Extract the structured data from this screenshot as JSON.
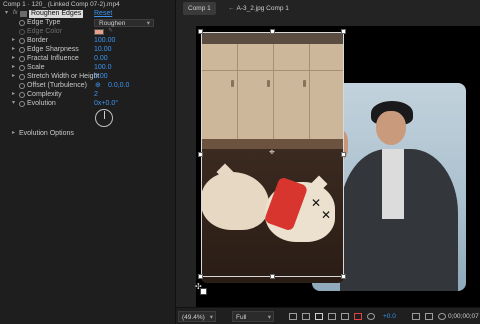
{
  "effect_controls": {
    "header": "Comp 1 · 120_ (Linked Comp 07-2).mp4",
    "effect_name": "Roughen Edges",
    "reset_label": "Reset",
    "properties": [
      {
        "label": "Edge Type",
        "value": "Roughen",
        "kind": "dropdown"
      },
      {
        "label": "Edge Color",
        "value": "",
        "kind": "color",
        "color": "#e8a08c",
        "disabled": true
      },
      {
        "label": "Border",
        "value": "100.00",
        "kind": "number"
      },
      {
        "label": "Edge Sharpness",
        "value": "10.00",
        "kind": "number"
      },
      {
        "label": "Fractal Influence",
        "value": "0.00",
        "kind": "number"
      },
      {
        "label": "Scale",
        "value": "100.0",
        "kind": "number"
      },
      {
        "label": "Stretch Width or Height",
        "value": "0.00",
        "kind": "number"
      },
      {
        "label": "Offset (Turbulence)",
        "value": "0.0,0.0",
        "kind": "point"
      },
      {
        "label": "Complexity",
        "value": "2",
        "kind": "number"
      },
      {
        "label": "Evolution",
        "value": "0x+0.0°",
        "kind": "angle"
      }
    ],
    "evolution_options_label": "Evolution Options"
  },
  "composition": {
    "active_tab": "Comp 1",
    "breadcrumb": "A-3_2.jpg Comp 1",
    "bottom_bar": {
      "zoom": "(49.4%)",
      "resolution": "Full",
      "exposure": "+0.0",
      "timecode": "0;00;00;07"
    }
  },
  "colors": {
    "value_blue": "#3b95f0",
    "panel_bg": "#1e1e1e",
    "edge_color_swatch": "#e8a08c"
  }
}
